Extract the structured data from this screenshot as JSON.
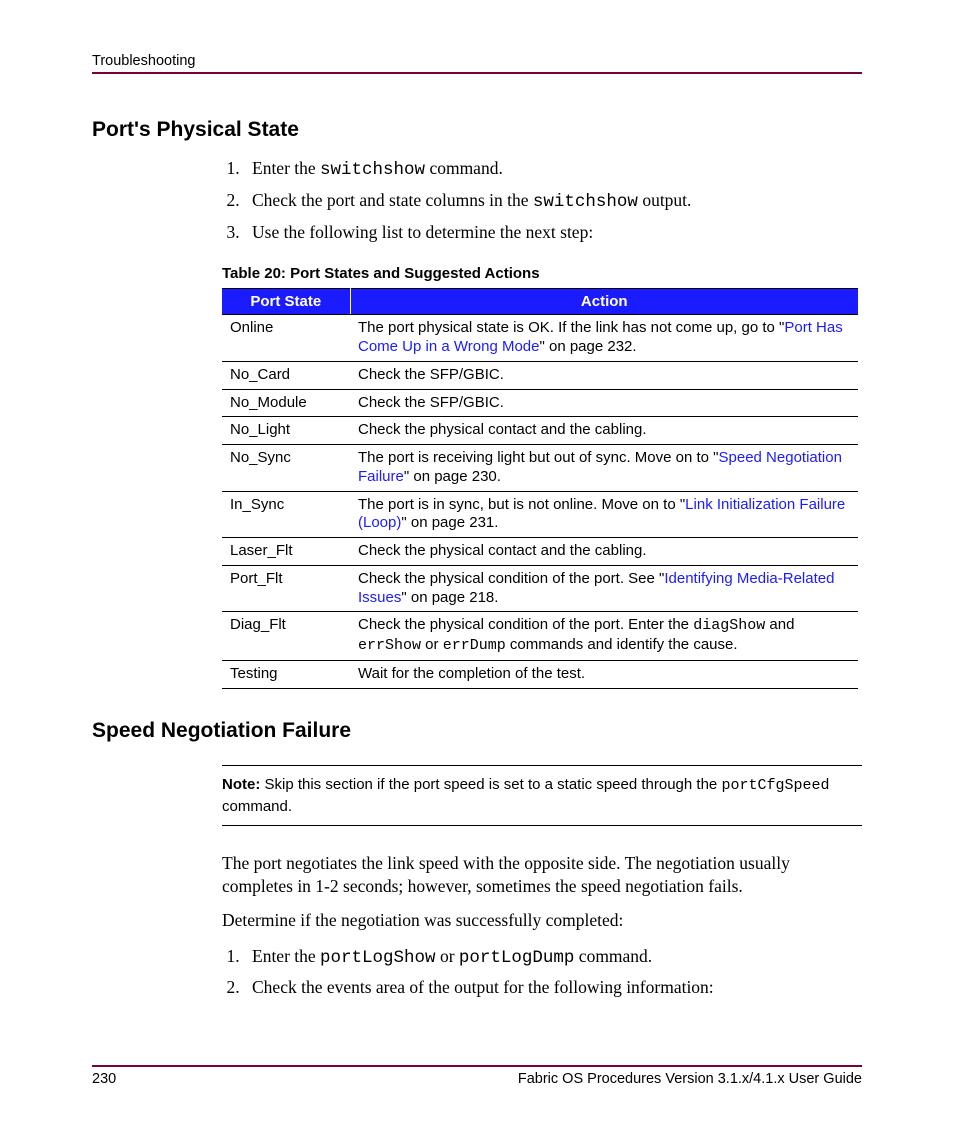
{
  "header": {
    "chapter": "Troubleshooting"
  },
  "section1": {
    "heading": "Port's Physical State",
    "steps": [
      {
        "pre": "Enter the ",
        "cmd": "switchshow",
        "post": " command."
      },
      {
        "pre": "Check the port and state columns in the ",
        "cmd": "switchshow",
        "post": " output."
      },
      {
        "pre": "Use the following list to determine the next step:",
        "cmd": "",
        "post": ""
      }
    ]
  },
  "table": {
    "caption": "Table 20:  Port States and Suggested Actions",
    "headers": {
      "col1": "Port State",
      "col2": "Action"
    },
    "rows": [
      {
        "state": "Online",
        "action_pre": "The port physical state is OK. If the link has not come up, go to \"",
        "link": "Port Has Come Up in a Wrong Mode",
        "action_post": "\" on page 232."
      },
      {
        "state": "No_Card",
        "action_pre": "Check the SFP/GBIC.",
        "link": "",
        "action_post": ""
      },
      {
        "state": "No_Module",
        "action_pre": "Check the SFP/GBIC.",
        "link": "",
        "action_post": ""
      },
      {
        "state": "No_Light",
        "action_pre": "Check the physical contact and the cabling.",
        "link": "",
        "action_post": ""
      },
      {
        "state": "No_Sync",
        "action_pre": "The port is receiving light but out of sync. Move on to \"",
        "link": "Speed Negotiation Failure",
        "action_post": "\" on page 230."
      },
      {
        "state": "In_Sync",
        "action_pre": "The port is in sync, but is not online. Move on to \"",
        "link": "Link Initialization Failure (Loop)",
        "action_post": "\" on page 231."
      },
      {
        "state": "Laser_Flt",
        "action_pre": "Check the physical contact and the cabling.",
        "link": "",
        "action_post": ""
      },
      {
        "state": "Port_Flt",
        "action_pre": "Check the physical condition of the port. See \"",
        "link": "Identifying Media-Related Issues",
        "action_post": "\" on page 218."
      },
      {
        "state": "Diag_Flt",
        "action_pre": "Check the physical condition of the port. Enter the ",
        "cmd1": "diagShow",
        "mid1": " and ",
        "cmd2": "errShow",
        "mid2": " or ",
        "cmd3": "errDump",
        "action_post": " commands and identify the cause."
      },
      {
        "state": "Testing",
        "action_pre": "Wait for the completion of the test.",
        "link": "",
        "action_post": ""
      }
    ]
  },
  "section2": {
    "heading": "Speed Negotiation Failure",
    "note_label": "Note:",
    "note_pre": "  Skip this section if the port speed is set to a static speed through the ",
    "note_cmd": "portCfgSpeed",
    "note_post": " command.",
    "p1": "The port negotiates the link speed with the opposite side. The negotiation usually completes in 1-2 seconds; however, sometimes the speed negotiation fails.",
    "p2": "Determine if the negotiation was successfully completed:",
    "steps": [
      {
        "pre": "Enter the ",
        "cmd1": "portLogShow",
        "mid": " or ",
        "cmd2": "portLogDump",
        "post": " command."
      },
      {
        "pre": "Check the events area of the output for the following information:",
        "cmd1": "",
        "mid": "",
        "cmd2": "",
        "post": ""
      }
    ]
  },
  "footer": {
    "page": "230",
    "doc": "Fabric OS Procedures Version 3.1.x/4.1.x User Guide"
  }
}
